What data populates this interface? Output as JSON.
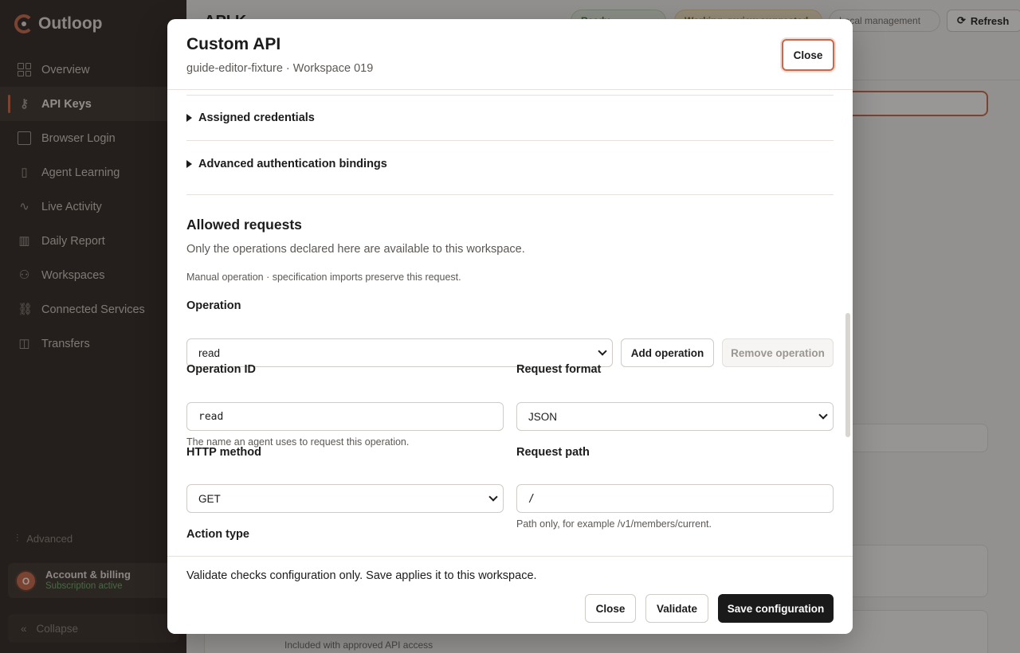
{
  "app": {
    "name": "Outloop"
  },
  "sidebar": {
    "items": [
      {
        "label": "Overview",
        "icon": "overview-grid-icon"
      },
      {
        "label": "API Keys",
        "icon": "key-icon",
        "active": true
      },
      {
        "label": "Browser Login",
        "icon": "browser-icon"
      },
      {
        "label": "Agent Learning",
        "icon": "book-icon"
      },
      {
        "label": "Live Activity",
        "icon": "activity-icon"
      },
      {
        "label": "Daily Report",
        "icon": "bar-chart-icon"
      },
      {
        "label": "Workspaces",
        "icon": "users-icon"
      },
      {
        "label": "Connected Services",
        "icon": "link-icon"
      },
      {
        "label": "Transfers",
        "icon": "transfer-icon"
      }
    ],
    "advanced_label": "Advanced",
    "account": {
      "initial": "O",
      "title": "Account & billing",
      "status": "Subscription active"
    },
    "collapse_label": "Collapse"
  },
  "background": {
    "page_title": "API K",
    "status_pills": [
      "Ready",
      "Working, review suggested",
      "Local management"
    ],
    "refresh_label": "Refresh",
    "bottom_card_text": "Included with approved API access"
  },
  "modal": {
    "title": "Custom API",
    "subtitle": "guide-editor-fixture · Workspace 019",
    "close_label": "Close",
    "disclosures": [
      "Assigned credentials",
      "Advanced authentication bindings"
    ],
    "section": {
      "title": "Allowed requests",
      "description": "Only the operations declared here are available to this workspace.",
      "note": "Manual operation · specification imports preserve this request."
    },
    "operation": {
      "label": "Operation",
      "value": "read",
      "add_label": "Add operation",
      "remove_label": "Remove operation"
    },
    "operation_id": {
      "label": "Operation ID",
      "value": "read",
      "hint": "The name an agent uses to request this operation."
    },
    "request_format": {
      "label": "Request format",
      "value": "JSON"
    },
    "http_method": {
      "label": "HTTP method",
      "value": "GET"
    },
    "request_path": {
      "label": "Request path",
      "value": "/",
      "hint": "Path only, for example /v1/members/current."
    },
    "action_type": {
      "label": "Action type"
    },
    "footer": {
      "text": "Validate checks configuration only. Save applies it to this workspace.",
      "close_label": "Close",
      "validate_label": "Validate",
      "save_label": "Save configuration"
    }
  },
  "colors": {
    "accent": "#c9684a",
    "sidebar_bg": "#2a2421",
    "primary_button": "#1a1a1a"
  }
}
